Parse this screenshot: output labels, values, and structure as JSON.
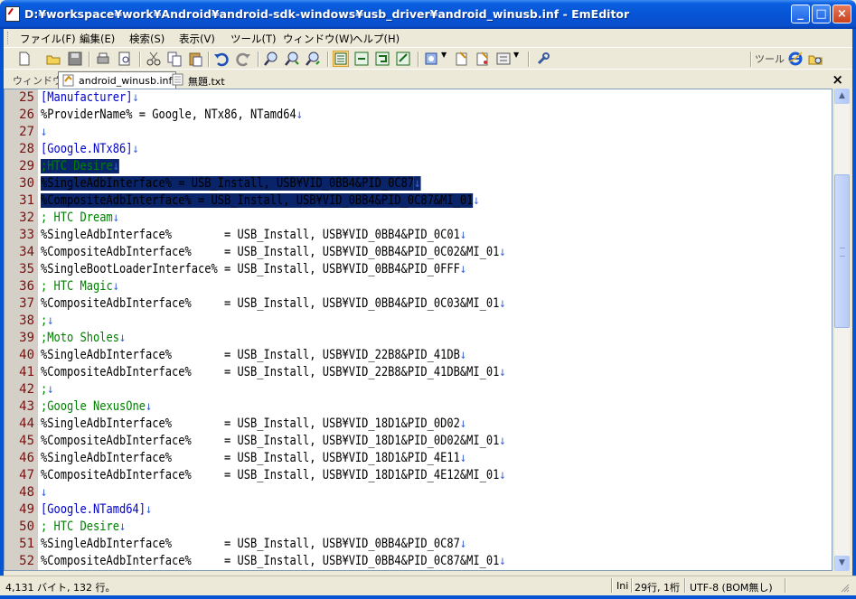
{
  "window": {
    "title": "D:¥workspace¥work¥Android¥android-sdk-windows¥usb_driver¥android_winusb.inf - EmEditor",
    "minimize": "_",
    "maximize": "□",
    "close": "×"
  },
  "menu": [
    "ファイル(F)",
    "編集(E)",
    "検索(S)",
    "表示(V)",
    "ツール(T)",
    "ウィンドウ(W)",
    "ヘルプ(H)"
  ],
  "toolbar": {
    "tools_label": "ツール"
  },
  "tabs": {
    "window_label": "ウィンドウ",
    "items": [
      {
        "label": "android_winusb.inf",
        "active": true
      },
      {
        "label": "無題.txt",
        "active": false
      }
    ],
    "close": "×"
  },
  "editor": {
    "eol_mark": "↓",
    "lines": [
      {
        "n": "25",
        "text": "[Manufacturer]",
        "kind": "sect",
        "sel": false
      },
      {
        "n": "26",
        "text": "%ProviderName% = Google, NTx86, NTamd64",
        "kind": "norm",
        "sel": false
      },
      {
        "n": "27",
        "text": "",
        "kind": "norm",
        "sel": false
      },
      {
        "n": "28",
        "text": "[Google.NTx86]",
        "kind": "sect",
        "sel": false
      },
      {
        "n": "29",
        "text": ";HTC Desire",
        "kind": "cmt",
        "sel": true
      },
      {
        "n": "30",
        "text": "%SingleAdbInterface% = USB_Install, USB¥VID_0BB4&PID_0C87",
        "kind": "norm",
        "sel": true
      },
      {
        "n": "31",
        "text": "%CompositeAdbInterface% = USB_Install, USB¥VID_0BB4&PID_0C87&MI_01",
        "kind": "norm",
        "sel": true
      },
      {
        "n": "32",
        "text": "; HTC Dream",
        "kind": "cmt",
        "sel": false
      },
      {
        "n": "33",
        "text": "%SingleAdbInterface%        = USB_Install, USB¥VID_0BB4&PID_0C01",
        "kind": "norm",
        "sel": false
      },
      {
        "n": "34",
        "text": "%CompositeAdbInterface%     = USB_Install, USB¥VID_0BB4&PID_0C02&MI_01",
        "kind": "norm",
        "sel": false
      },
      {
        "n": "35",
        "text": "%SingleBootLoaderInterface% = USB_Install, USB¥VID_0BB4&PID_0FFF",
        "kind": "norm",
        "sel": false
      },
      {
        "n": "36",
        "text": "; HTC Magic",
        "kind": "cmt",
        "sel": false
      },
      {
        "n": "37",
        "text": "%CompositeAdbInterface%     = USB_Install, USB¥VID_0BB4&PID_0C03&MI_01",
        "kind": "norm",
        "sel": false
      },
      {
        "n": "38",
        "text": ";",
        "kind": "cmt",
        "sel": false
      },
      {
        "n": "39",
        "text": ";Moto Sholes",
        "kind": "cmt",
        "sel": false
      },
      {
        "n": "40",
        "text": "%SingleAdbInterface%        = USB_Install, USB¥VID_22B8&PID_41DB",
        "kind": "norm",
        "sel": false
      },
      {
        "n": "41",
        "text": "%CompositeAdbInterface%     = USB_Install, USB¥VID_22B8&PID_41DB&MI_01",
        "kind": "norm",
        "sel": false
      },
      {
        "n": "42",
        "text": ";",
        "kind": "cmt",
        "sel": false
      },
      {
        "n": "43",
        "text": ";Google NexusOne",
        "kind": "cmt",
        "sel": false
      },
      {
        "n": "44",
        "text": "%SingleAdbInterface%        = USB_Install, USB¥VID_18D1&PID_0D02",
        "kind": "norm",
        "sel": false
      },
      {
        "n": "45",
        "text": "%CompositeAdbInterface%     = USB_Install, USB¥VID_18D1&PID_0D02&MI_01",
        "kind": "norm",
        "sel": false
      },
      {
        "n": "46",
        "text": "%SingleAdbInterface%        = USB_Install, USB¥VID_18D1&PID_4E11",
        "kind": "norm",
        "sel": false
      },
      {
        "n": "47",
        "text": "%CompositeAdbInterface%     = USB_Install, USB¥VID_18D1&PID_4E12&MI_01",
        "kind": "norm",
        "sel": false
      },
      {
        "n": "48",
        "text": "",
        "kind": "norm",
        "sel": false
      },
      {
        "n": "49",
        "text": "[Google.NTamd64]",
        "kind": "sect",
        "sel": false
      },
      {
        "n": "50",
        "text": "; HTC Desire",
        "kind": "cmt",
        "sel": false
      },
      {
        "n": "51",
        "text": "%SingleAdbInterface%        = USB_Install, USB¥VID_0BB4&PID_0C87",
        "kind": "norm",
        "sel": false
      },
      {
        "n": "52",
        "text": "%CompositeAdbInterface%     = USB_Install, USB¥VID_0BB4&PID_0C87&MI_01",
        "kind": "norm",
        "sel": false
      }
    ]
  },
  "scrollbar": {
    "up": "▲",
    "down": "▼"
  },
  "status": {
    "size": "4,131 バイト, 132 行。",
    "mode": "Ini",
    "position": "29行, 1桁",
    "encoding": "UTF-8 (BOM無し)"
  },
  "colors": {
    "section": "#0000cc",
    "comment": "#008000",
    "selection": "#0a246a",
    "line_number": "#7a1010",
    "eol": "#3a64d4"
  }
}
